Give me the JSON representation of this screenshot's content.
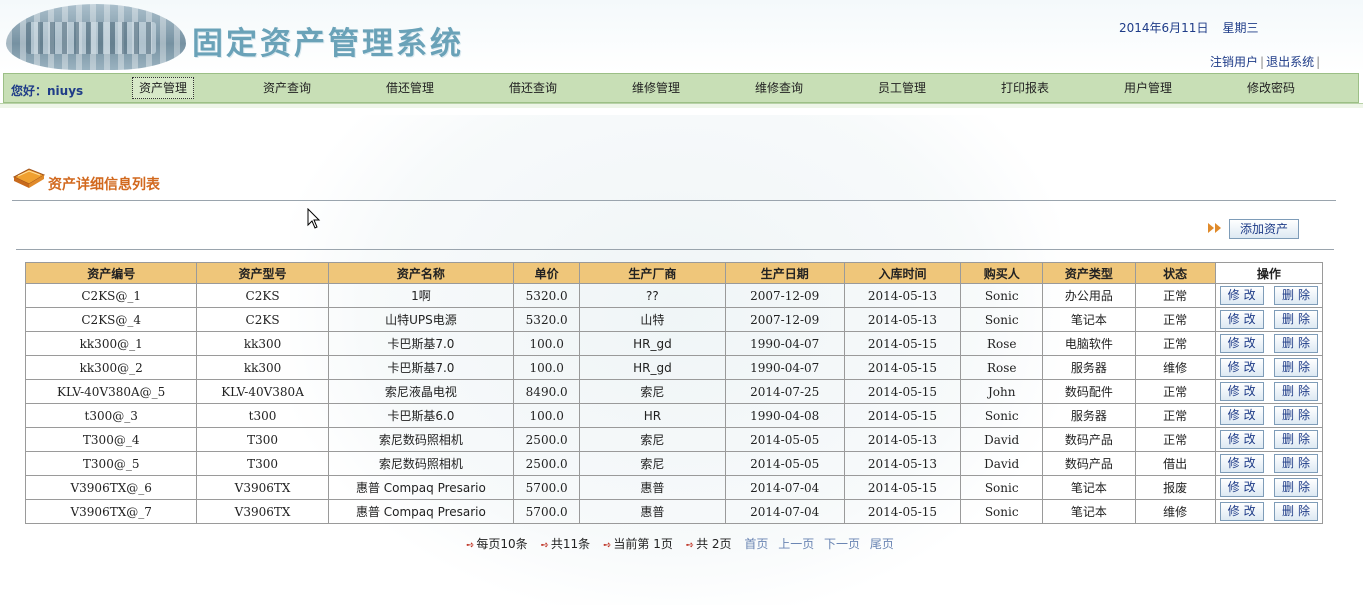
{
  "header": {
    "title": "固定资产管理系统",
    "date": "2014年6月11日",
    "weekday": "星期三",
    "logout_user": "注销用户",
    "separator": "|",
    "exit_system": "退出系统"
  },
  "nav": {
    "greeting": "您好：niuys",
    "items": [
      "资产管理",
      "资产查询",
      "借还管理",
      "借还查询",
      "维修管理",
      "维修查询",
      "员工管理",
      "打印报表",
      "用户管理",
      "修改密码"
    ],
    "active_index": 0
  },
  "page": {
    "heading": "资产详细信息列表",
    "add_button": "添加资产"
  },
  "table": {
    "columns": [
      "资产编号",
      "资产型号",
      "资产名称",
      "单价",
      "生产厂商",
      "生产日期",
      "入库时间",
      "购买人",
      "资产类型",
      "状态",
      "操作"
    ],
    "edit_label": "修改",
    "delete_label": "删除",
    "rows": [
      [
        "C2KS@_1",
        "C2KS",
        "1啊",
        "5320.0",
        "??",
        "2007-12-09",
        "2014-05-13",
        "Sonic",
        "办公用品",
        "正常"
      ],
      [
        "C2KS@_4",
        "C2KS",
        "山特UPS电源",
        "5320.0",
        "山特",
        "2007-12-09",
        "2014-05-13",
        "Sonic",
        "笔记本",
        "正常"
      ],
      [
        "kk300@_1",
        "kk300",
        "卡巴斯基7.0",
        "100.0",
        "HR_gd",
        "1990-04-07",
        "2014-05-15",
        "Rose",
        "电脑软件",
        "正常"
      ],
      [
        "kk300@_2",
        "kk300",
        "卡巴斯基7.0",
        "100.0",
        "HR_gd",
        "1990-04-07",
        "2014-05-15",
        "Rose",
        "服务器",
        "维修"
      ],
      [
        "KLV-40V380A@_5",
        "KLV-40V380A",
        "索尼液晶电视",
        "8490.0",
        "索尼",
        "2014-07-25",
        "2014-05-15",
        "John",
        "数码配件",
        "正常"
      ],
      [
        "t300@_3",
        "t300",
        "卡巴斯基6.0",
        "100.0",
        "HR",
        "1990-04-08",
        "2014-05-15",
        "Sonic",
        "服务器",
        "正常"
      ],
      [
        "T300@_4",
        "T300",
        "索尼数码照相机",
        "2500.0",
        "索尼",
        "2014-05-05",
        "2014-05-13",
        "David",
        "数码产品",
        "正常"
      ],
      [
        "T300@_5",
        "T300",
        "索尼数码照相机",
        "2500.0",
        "索尼",
        "2014-05-05",
        "2014-05-13",
        "David",
        "数码产品",
        "借出"
      ],
      [
        "V3906TX@_6",
        "V3906TX",
        "惠普  Compaq Presario",
        "5700.0",
        "惠普",
        "2014-07-04",
        "2014-05-15",
        "Sonic",
        "笔记本",
        "报废"
      ],
      [
        "V3906TX@_7",
        "V3906TX",
        "惠普  Compaq Presario",
        "5700.0",
        "惠普",
        "2014-07-04",
        "2014-05-15",
        "Sonic",
        "笔记本",
        "维修"
      ]
    ]
  },
  "pager": {
    "per_page": "每页10条",
    "total": "共11条",
    "current": "当前第  1页",
    "pages": "共  2页",
    "first": "首页",
    "prev": "上一页",
    "next": "下一页",
    "last": "尾页"
  },
  "colors": {
    "header_text": "#6aa2b8",
    "nav_bg": "#c8dfb6",
    "table_header_bg": "#efc67a",
    "heading_orange": "#d2691e",
    "link_blue": "#1f3c88"
  }
}
